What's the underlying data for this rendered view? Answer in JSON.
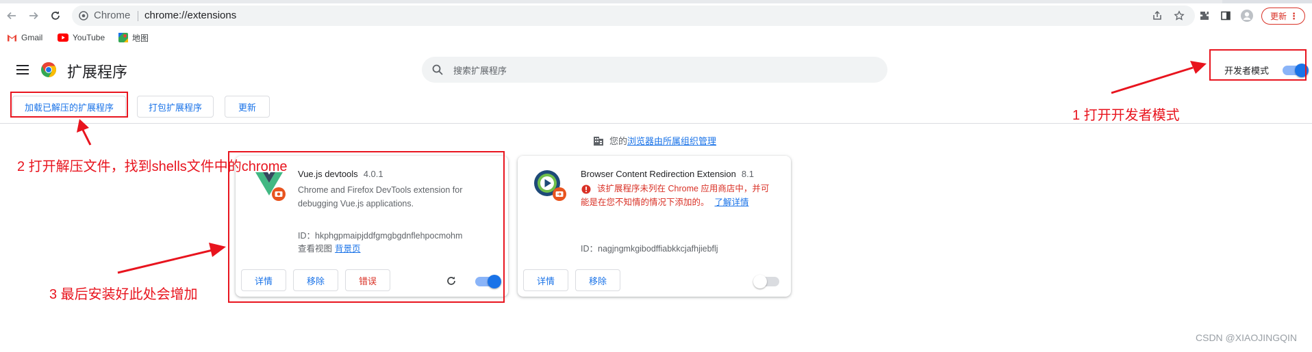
{
  "browser": {
    "site_chip": "Chrome",
    "url": "chrome://extensions",
    "update_label": "更新",
    "bookmarks": [
      {
        "label": "Gmail",
        "icon": "gmail-icon"
      },
      {
        "label": "YouTube",
        "icon": "youtube-icon"
      },
      {
        "label": "地图",
        "icon": "maps-icon"
      }
    ]
  },
  "header": {
    "title": "扩展程序",
    "search_placeholder": "搜索扩展程序",
    "dev_mode_label": "开发者模式",
    "dev_mode_on": true
  },
  "actions": {
    "load_unpacked": "加载已解压的扩展程序",
    "pack": "打包扩展程序",
    "update": "更新"
  },
  "managed": {
    "prefix": "您的",
    "link": "浏览器由所属组织管理"
  },
  "extensions": [
    {
      "name": "Vue.js devtools",
      "version": "4.0.1",
      "description_line1": "Chrome and Firefox DevTools extension for",
      "description_line2": "debugging Vue.js applications.",
      "id_line": "ID：hkphgpmaipjddfgmgbgdnflehpocmohm",
      "view_label": "查看视图",
      "view_link": "背景页",
      "details_btn": "详情",
      "remove_btn": "移除",
      "errors_btn": "错误",
      "enabled": true
    },
    {
      "name": "Browser Content Redirection Extension",
      "version": "8.1",
      "warning_line1": "该扩展程序未列在 Chrome 应用商店中，并可",
      "warning_line2": "能是在您不知情的情况下添加的。",
      "warning_link": "了解详情",
      "id_line": "ID：nagjngmkgibodffiabkkcjafhjiebflj",
      "details_btn": "详情",
      "remove_btn": "移除",
      "enabled": false
    }
  ],
  "annotations": {
    "step1": "1 打开开发者模式",
    "step2": "2 打开解压文件，找到shells文件中的chrome",
    "step3": "3 最后安装好此处会增加"
  },
  "watermark": "CSDN @XIAOJINGQIN",
  "colors": {
    "accent": "#1a73e8",
    "annotation_red": "#e8141e",
    "error_red": "#d93025",
    "vue_green": "#41b883",
    "vue_dark": "#35495e"
  }
}
